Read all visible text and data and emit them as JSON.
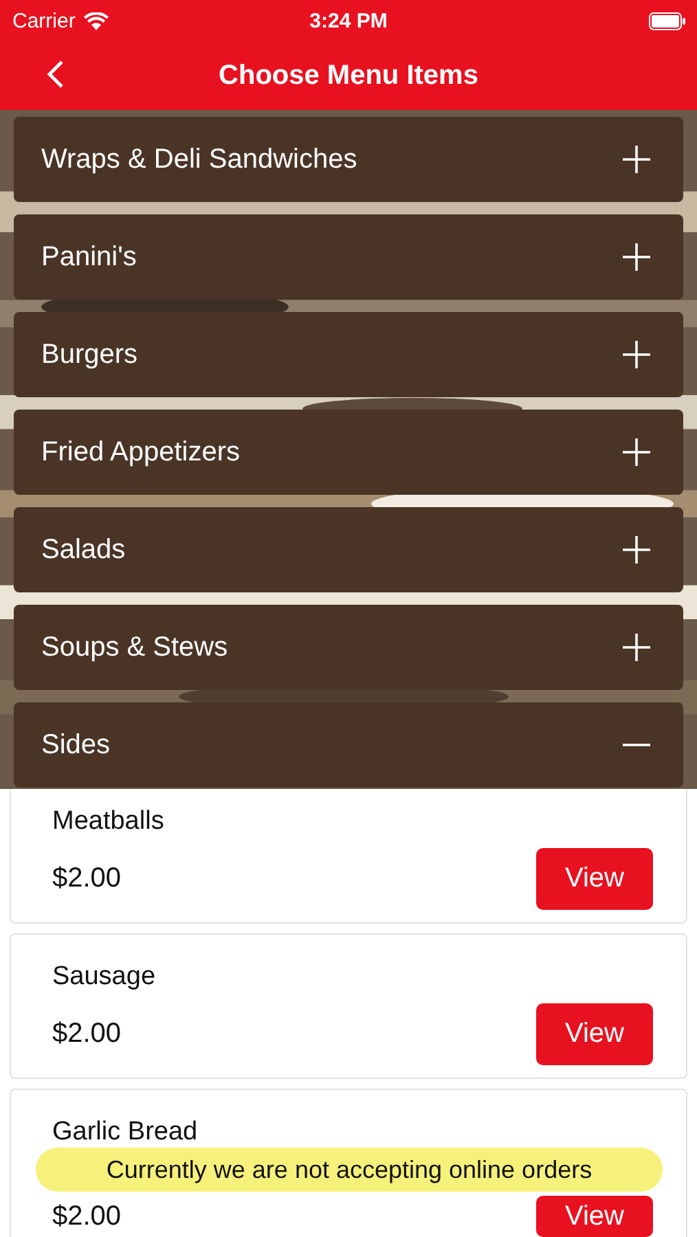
{
  "status_bar": {
    "carrier": "Carrier",
    "time": "3:24 PM"
  },
  "nav": {
    "title": "Choose Menu Items"
  },
  "categories": [
    {
      "name": "Wraps & Deli Sandwiches",
      "expanded": false
    },
    {
      "name": "Panini's",
      "expanded": false
    },
    {
      "name": "Burgers",
      "expanded": false
    },
    {
      "name": "Fried Appetizers",
      "expanded": false
    },
    {
      "name": "Salads",
      "expanded": false
    },
    {
      "name": "Soups & Stews",
      "expanded": false
    },
    {
      "name": "Sides",
      "expanded": true
    }
  ],
  "items": [
    {
      "name": "Meatballs",
      "price": "$2.00",
      "button": "View"
    },
    {
      "name": "Sausage",
      "price": "$2.00",
      "button": "View"
    },
    {
      "name": "Garlic Bread",
      "price": "$2.00",
      "button": "View"
    }
  ],
  "toast": "Currently we are not accepting online orders"
}
